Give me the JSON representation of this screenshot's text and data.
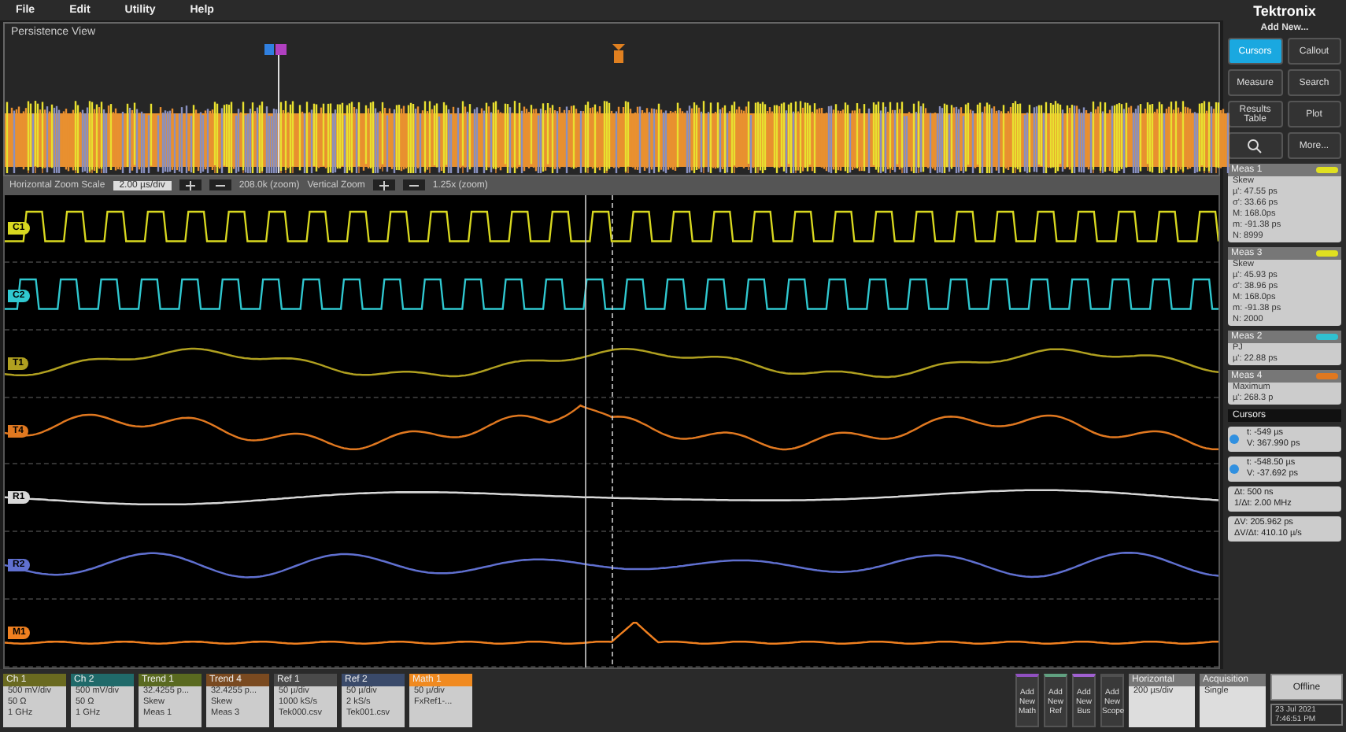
{
  "menu": [
    "File",
    "Edit",
    "Utility",
    "Help"
  ],
  "logo": "Tektronix",
  "overview": {
    "title": "Persistence View"
  },
  "zoom_bar": {
    "scale_label": "Horizontal Zoom Scale",
    "scale_value": "2.00 µs/div",
    "position": "208.0k (zoom)",
    "vertical_label": "Vertical Zoom",
    "vertical_value": "1.25x (zoom)"
  },
  "lanes": [
    {
      "label": "C1",
      "kind": "square",
      "color": "#d8d820"
    },
    {
      "label": "C2",
      "kind": "square",
      "color": "#30c8d0"
    },
    {
      "label": "T1",
      "kind": "trend",
      "color": "#b0a020"
    },
    {
      "label": "T4",
      "kind": "trend",
      "color": "#e07820"
    },
    {
      "label": "R1",
      "kind": "ref",
      "color": "#d8d8d8"
    },
    {
      "label": "R2",
      "kind": "ref",
      "color": "#6070d0"
    },
    {
      "label": "M1",
      "kind": "math",
      "color": "#f08020"
    }
  ],
  "side": {
    "add_new": "Add New...",
    "buttons": [
      {
        "label": "Cursors",
        "selected": true
      },
      {
        "label": "Callout",
        "selected": false
      },
      {
        "label": "Measure",
        "selected": false
      },
      {
        "label": "Search",
        "selected": false
      },
      {
        "label": "Results Table",
        "selected": false
      },
      {
        "label": "Plot",
        "selected": false
      },
      {
        "kind": "icon",
        "selected": false
      },
      {
        "label": "More...",
        "selected": false
      }
    ]
  },
  "measurements": [
    {
      "title": "Meas 1",
      "color": "#e0e020",
      "lines": [
        "Skew",
        "µ': 47.55 ps",
        "σ': 33.66 ps",
        "M: 168.0ps",
        "m: -91.38 ps",
        "N: 8999"
      ]
    },
    {
      "title": "Meas 3",
      "color": "#e0e020",
      "lines": [
        "Skew",
        "µ': 45.93 ps",
        "σ': 38.96 ps",
        "M: 168.0ps",
        "m: -91.38 ps",
        "N: 2000"
      ]
    },
    {
      "title": "Meas 2",
      "color": "#30c0d0",
      "lines": [
        "PJ",
        "µ': 22.88 ps"
      ]
    },
    {
      "title": "Meas 4",
      "color": "#e07820",
      "lines": [
        "Maximum",
        "µ': 268.3 p"
      ]
    }
  ],
  "cursors": {
    "title": "Cursors",
    "readouts": [
      [
        "t: -549 µs",
        "V: 367.990 ps"
      ],
      [
        "t: -548.50 µs",
        "V: -37.692 ps"
      ]
    ],
    "deltas": [
      [
        "Δt: 500 ns",
        "1/Δt: 2.00 MHz"
      ],
      [
        "ΔV: 205.962 ps",
        "ΔV/Δt: 410.10 µ/s"
      ]
    ]
  },
  "badges": [
    {
      "title": "Ch 1",
      "color": "#6a6a20",
      "lines": [
        "500 mV/div",
        "50 Ω",
        "1 GHz"
      ]
    },
    {
      "title": "Ch 2",
      "color": "#206a6a",
      "lines": [
        "500 mV/div",
        "50 Ω",
        "1 GHz"
      ]
    },
    {
      "title": "Trend 1",
      "color": "#5a6a20",
      "lines": [
        "32.4255 p...",
        "Skew",
        "Meas 1"
      ]
    },
    {
      "title": "Trend 4",
      "color": "#7a4a20",
      "lines": [
        "32.4255 p...",
        "Skew",
        "Meas 3"
      ]
    },
    {
      "title": "Ref 1",
      "color": "#4a4a4a",
      "lines": [
        "50 µ/div",
        "1000 kS/s",
        "Tek000.csv"
      ]
    },
    {
      "title": "Ref 2",
      "color": "#3a4a6a",
      "lines": [
        "50 µ/div",
        "2 kS/s",
        "Tek001.csv"
      ]
    },
    {
      "title": "Math 1",
      "color": "#f08a20",
      "lines": [
        "50 µ/div",
        "FxRef1-..."
      ]
    }
  ],
  "add_buttons": [
    {
      "label": "Add New Math",
      "color": "#9050c0"
    },
    {
      "label": "Add New Ref",
      "color": "#60a080"
    },
    {
      "label": "Add New Bus",
      "color": "#a060d0"
    },
    {
      "label": "Add New Scope",
      "color": "#505050"
    }
  ],
  "horizontal": {
    "title": "Horizontal",
    "value": "200 µs/div"
  },
  "acquisition": {
    "title": "Acquisition",
    "value": "Single"
  },
  "offline": "Offline",
  "clock": [
    "23 Jul 2021",
    "7:46:51 PM"
  ]
}
